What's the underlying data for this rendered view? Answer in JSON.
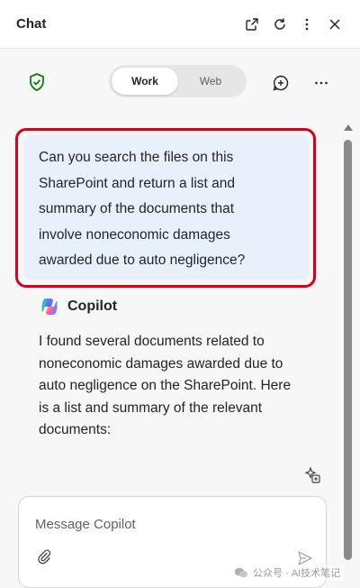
{
  "header": {
    "title": "Chat"
  },
  "toolbar": {
    "mode_options": [
      "Work",
      "Web"
    ],
    "selected_mode": "Work"
  },
  "conversation": {
    "user_message_lines": [
      "Can you search the files on this",
      "SharePoint and return a list and",
      "summary of the documents that",
      "involve noneconomic damages",
      "awarded due to auto negligence?"
    ],
    "assistant_name": "Copilot",
    "assistant_message_lines": [
      "I found several documents related to",
      "noneconomic damages awarded due to",
      "auto negligence on the SharePoint. Here",
      "is a list and summary of the relevant",
      "documents:"
    ]
  },
  "composer": {
    "placeholder": "Message Copilot"
  },
  "watermark": {
    "text": "公众号 · AI技术笔记"
  },
  "colors": {
    "highlight_outline": "#d9001b",
    "user_bubble": "#e8f1fb",
    "shield_green": "#107c10"
  },
  "icons": {
    "header": [
      "open-external-icon",
      "refresh-icon",
      "more-vertical-icon",
      "close-icon"
    ],
    "toolbar": [
      "shield-check-icon",
      "new-chat-icon",
      "more-horizontal-icon"
    ],
    "composer": [
      "paperclip-icon",
      "send-icon"
    ]
  }
}
